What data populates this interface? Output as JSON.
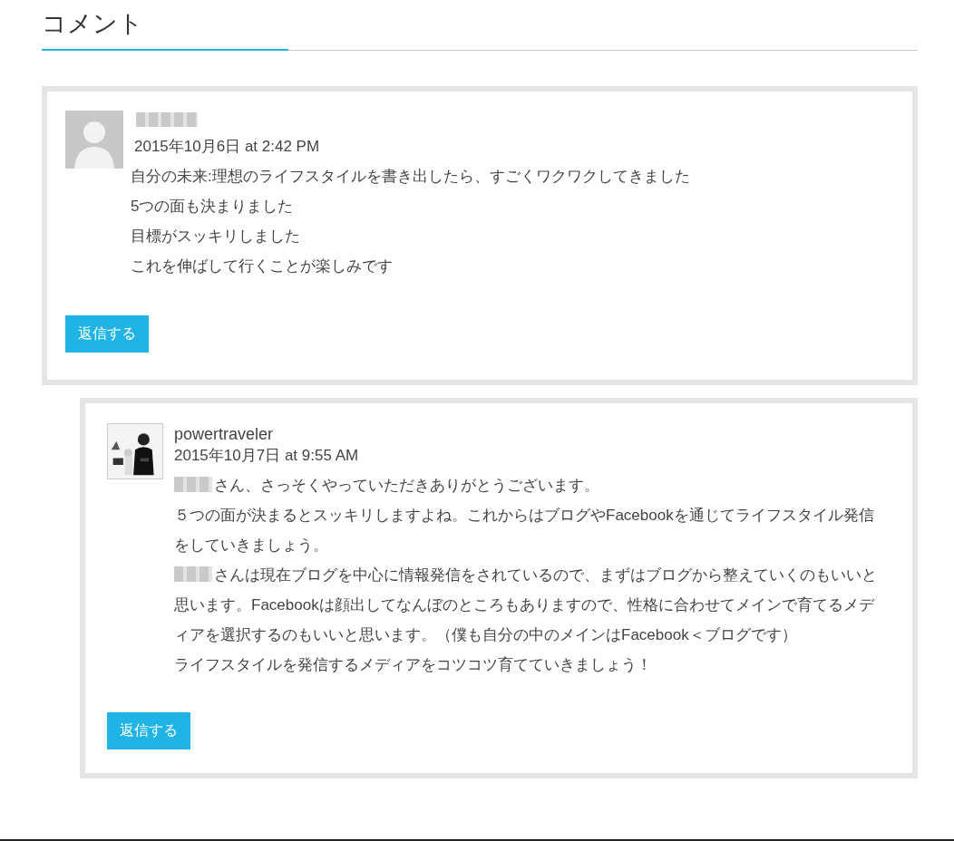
{
  "heading": "コメント",
  "comments": [
    {
      "author": {
        "name_redacted": true
      },
      "kind": "default_avatar",
      "date": "2015年10月6日 at 2:42 PM",
      "indent": false,
      "lines": [
        {
          "text": "自分の未来:理想のライフスタイルを書き出したら、すごくワクワクしてきました",
          "redacted_prefix": false
        },
        {
          "text": "5つの面も決まりました",
          "redacted_prefix": false
        },
        {
          "text": "目標がスッキリしました",
          "redacted_prefix": false
        },
        {
          "text": "これを伸ばして行くことが楽しみです",
          "redacted_prefix": false
        }
      ],
      "reply_button": "返信する"
    },
    {
      "author": {
        "name": "powertraveler",
        "name_redacted": false
      },
      "kind": "photo_avatar",
      "date": "2015年10月7日 at 9:55 AM",
      "indent": true,
      "lines": [
        {
          "text": "さん、さっそくやっていただきありがとうございます。",
          "redacted_prefix": true
        },
        {
          "text": "５つの面が決まるとスッキリしますよね。これからはブログやFacebookを通じてライフスタイル発信をしていきましょう。",
          "redacted_prefix": false
        },
        {
          "text": "さんは現在ブログを中心に情報発信をされているので、まずはブログから整えていくのもいいと思います。Facebookは顔出してなんぼのところもありますので、性格に合わせてメインで育てるメディアを選択するのもいいと思います。（僕も自分の中のメインはFacebook＜ブログです）",
          "redacted_prefix": true
        },
        {
          "text": "ライフスタイルを発信するメディアをコツコツ育てていきましょう！",
          "redacted_prefix": false
        }
      ],
      "reply_button": "返信する"
    }
  ]
}
